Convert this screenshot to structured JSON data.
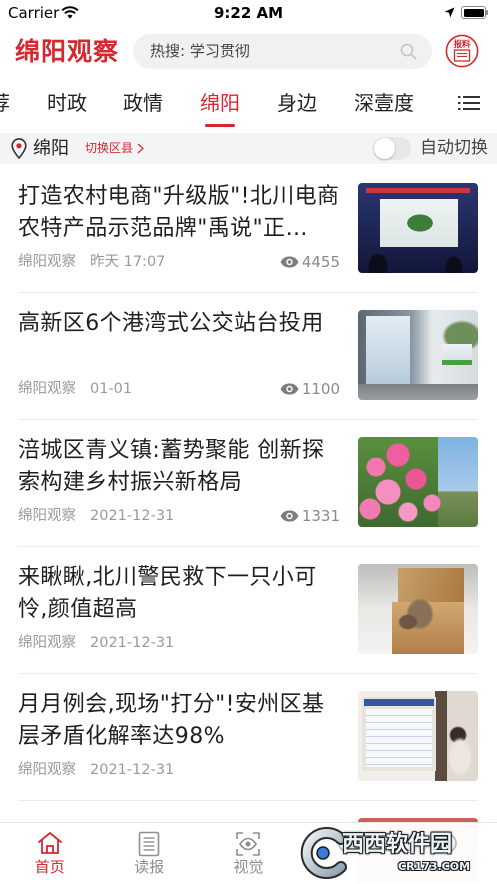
{
  "status_bar": {
    "carrier": "Carrier",
    "time": "9:22 AM"
  },
  "header": {
    "logo": "绵阳观察",
    "search_placeholder": "热搜: 学习贯彻",
    "report_badge": "报料"
  },
  "tabs": [
    {
      "label": "荐"
    },
    {
      "label": "时政"
    },
    {
      "label": "政情"
    },
    {
      "label": "绵阳",
      "active": true
    },
    {
      "label": "身边"
    },
    {
      "label": "深壹度"
    }
  ],
  "location_bar": {
    "city": "绵阳",
    "switch_district": "切换区县",
    "auto_switch": "自动切换",
    "auto_switch_on": false
  },
  "news": [
    {
      "title": "打造农村电商\"升级版\"!北川电商农特产品示范品牌\"禹说\"正…",
      "source": "绵阳观察",
      "time": "昨天 17:07",
      "views": "4455"
    },
    {
      "title": "高新区6个港湾式公交站台投用",
      "source": "绵阳观察",
      "time": "01-01",
      "views": "1100"
    },
    {
      "title": "涪城区青义镇:蓄势聚能 创新探索构建乡村振兴新格局",
      "source": "绵阳观察",
      "time": "2021-12-31",
      "views": "1331"
    },
    {
      "title": "来瞅瞅,北川警民救下一只小可怜,颜值超高",
      "source": "绵阳观察",
      "time": "2021-12-31"
    },
    {
      "title": "月月例会,现场\"打分\"!安州区基层矛盾化解率达98%",
      "source": "绵阳观察",
      "time": "2021-12-31"
    }
  ],
  "tab_bar": [
    {
      "label": "首页",
      "icon": "home-icon",
      "active": true
    },
    {
      "label": "读报",
      "icon": "newspaper-icon"
    },
    {
      "label": "视觉",
      "icon": "eye-frame-icon"
    }
  ],
  "watermark": {
    "name": "西西软件园",
    "url": "CR173.COM"
  },
  "colors": {
    "accent": "#d7282f",
    "title_text": "#1f1f1f",
    "meta_text": "#9a9a9a",
    "location_bar_bg": "#f3f4f6",
    "search_bg": "#f1f1f1"
  }
}
